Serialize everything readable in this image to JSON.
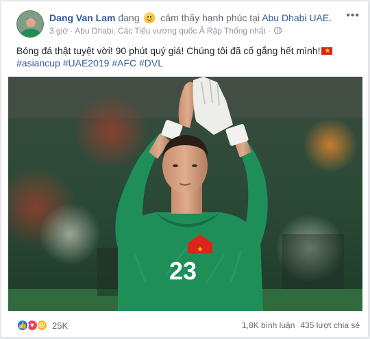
{
  "post": {
    "author": "Dang Van Lam",
    "feeling_prefix": "đang",
    "feeling_text": "cảm thấy hạnh phúc tại",
    "location": "Abu Dhabi UAE.",
    "time": "3 giờ",
    "place_detail": "Abu Dhabi, Các Tiểu vương quốc Ả Rập Thống nhất",
    "separator": "·",
    "text": "Bóng đá thật tuyệt vời! 90 phút quý giá! Chúng tôi đã cố gắng hết mình!",
    "hashtags": [
      "#asiancup",
      "#UAE2019",
      "#AFC",
      "#DVL"
    ],
    "photo": {
      "jersey_number": "23"
    }
  },
  "footer": {
    "reaction_count": "25K",
    "comments": "1,8K bình luận",
    "shares": "435 lượt chia sẻ"
  },
  "colors": {
    "link": "#365899",
    "jersey": "#1f8f5a",
    "like": "#1877f2",
    "love": "#f33e58",
    "haha": "#f7b928"
  }
}
